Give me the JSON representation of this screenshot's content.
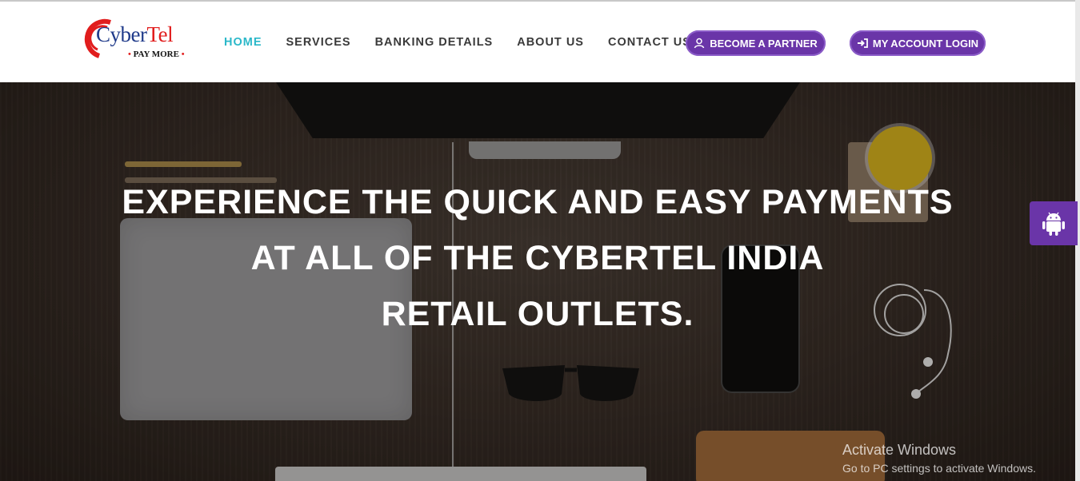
{
  "brand": {
    "name_part1": "Cyber",
    "name_part2": "Tel",
    "tagline": "PAY MORE"
  },
  "nav": {
    "items": [
      {
        "label": "HOME",
        "active": true
      },
      {
        "label": "SERVICES",
        "active": false
      },
      {
        "label": "BANKING DETAILS",
        "active": false
      },
      {
        "label": "ABOUT US",
        "active": false
      },
      {
        "label": "CONTACT US",
        "active": false
      }
    ]
  },
  "actions": {
    "partner_label": "BECOME A PARTNER",
    "partner_icon": "user-icon",
    "login_label": "MY ACCOUNT LOGIN",
    "login_icon": "sign-in-icon"
  },
  "hero": {
    "line1": "EXPERIENCE THE QUICK AND EASY PAYMENTS",
    "line2": "AT ALL OF THE CYBERTEL INDIA",
    "line3": "RETAIL OUTLETS."
  },
  "side_tab": {
    "icon": "android-icon"
  },
  "watermark": {
    "title": "Activate Windows",
    "subtitle": "Go to PC settings to activate Windows."
  },
  "colors": {
    "accent": "#6a35a8",
    "nav_active": "#2bb8c9",
    "brand_blue": "#1f3a8a",
    "brand_red": "#e11d1d"
  }
}
